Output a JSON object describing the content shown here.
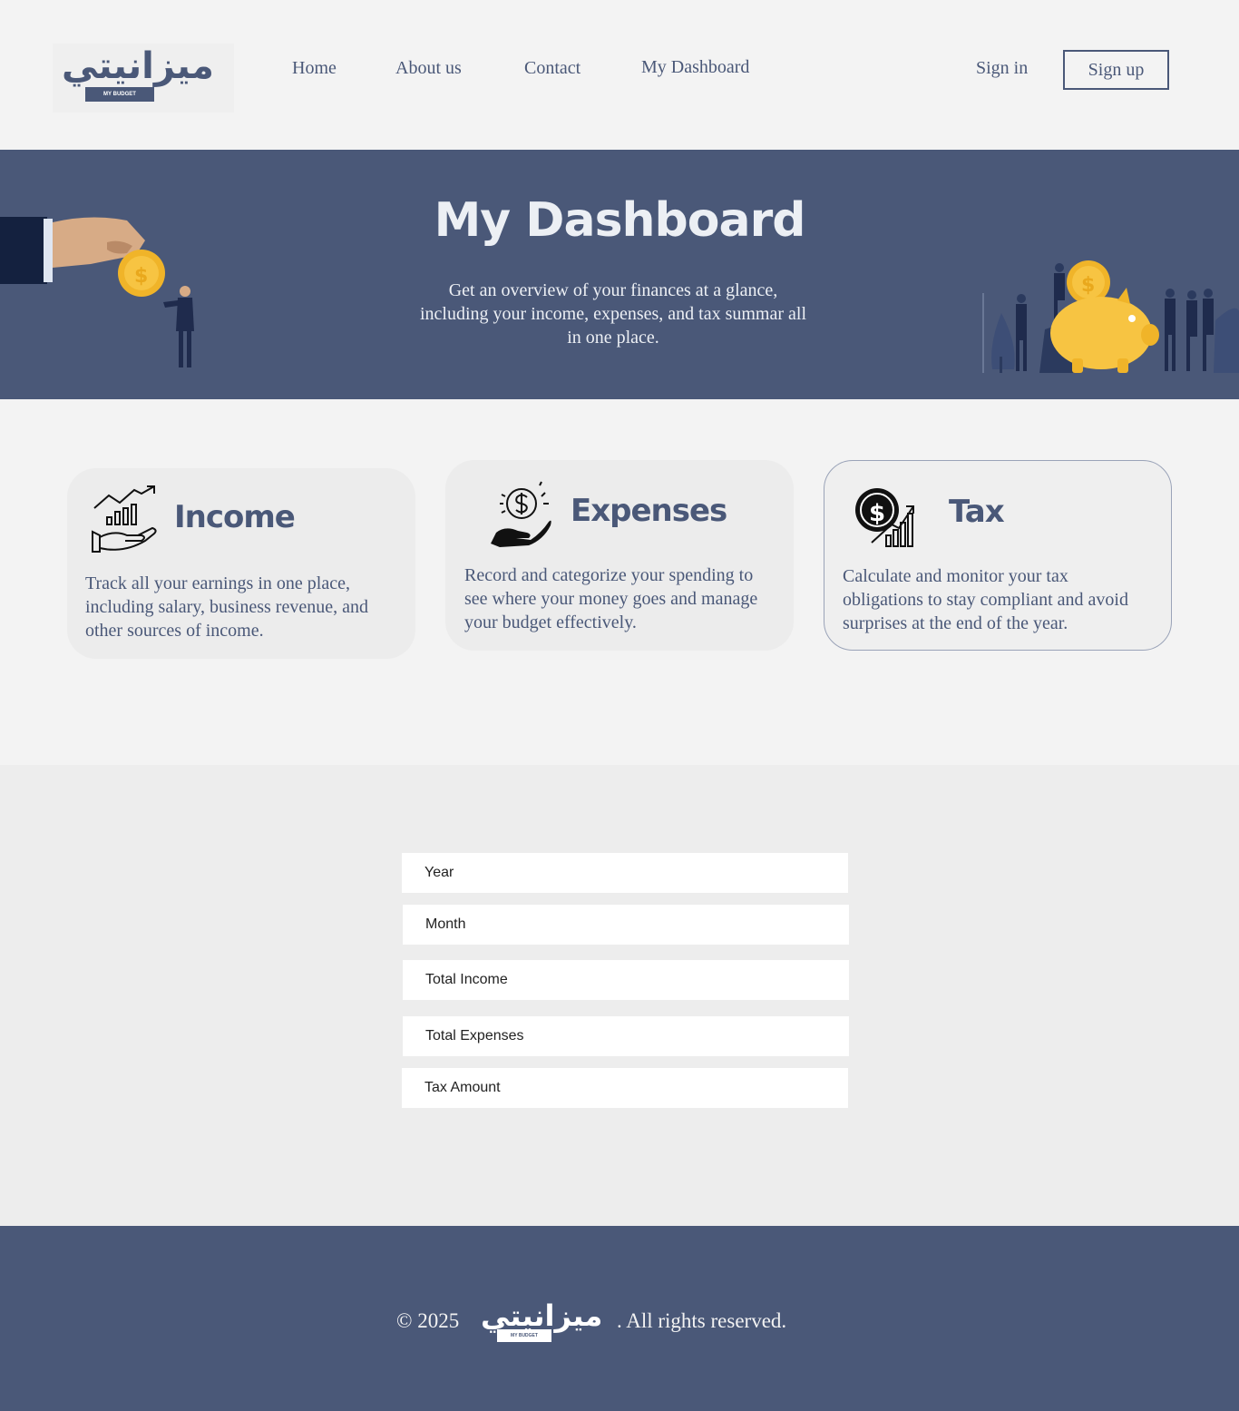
{
  "brand": {
    "logo_text": "ميزانيتي",
    "logo_tag": "MY BUDGET"
  },
  "nav": {
    "home": "Home",
    "about": "About us",
    "contact": "Contact",
    "dashboard": "My Dashboard",
    "sign_in": "Sign in",
    "sign_up": "Sign up"
  },
  "hero": {
    "title": "My Dashboard",
    "subtitle": "Get an overview of your finances at a glance, including your income, expenses, and tax summar all in one place."
  },
  "cards": [
    {
      "title": "Income",
      "text": "Track all your earnings in one place, including salary, business revenue, and other sources of income.",
      "icon": "income-growth-hand-icon"
    },
    {
      "title": "Expenses",
      "text": "Record and categorize your spending to see where your money goes and manage your budget effectively.",
      "icon": "coin-hand-icon"
    },
    {
      "title": "Tax",
      "text": "Calculate and monitor your tax obligations to stay compliant and avoid surprises at the end of the year.",
      "icon": "dollar-chart-icon"
    }
  ],
  "form": {
    "year": "Year",
    "month": "Month",
    "total_income": "Total Income",
    "total_expenses": "Total Expenses",
    "tax_amount": "Tax Amount"
  },
  "footer": {
    "copyright": "© 2025",
    "rights": ". All rights reserved."
  },
  "colors": {
    "primary": "#4a5878",
    "background": "#f3f3f3",
    "coin": "#f7c442"
  }
}
